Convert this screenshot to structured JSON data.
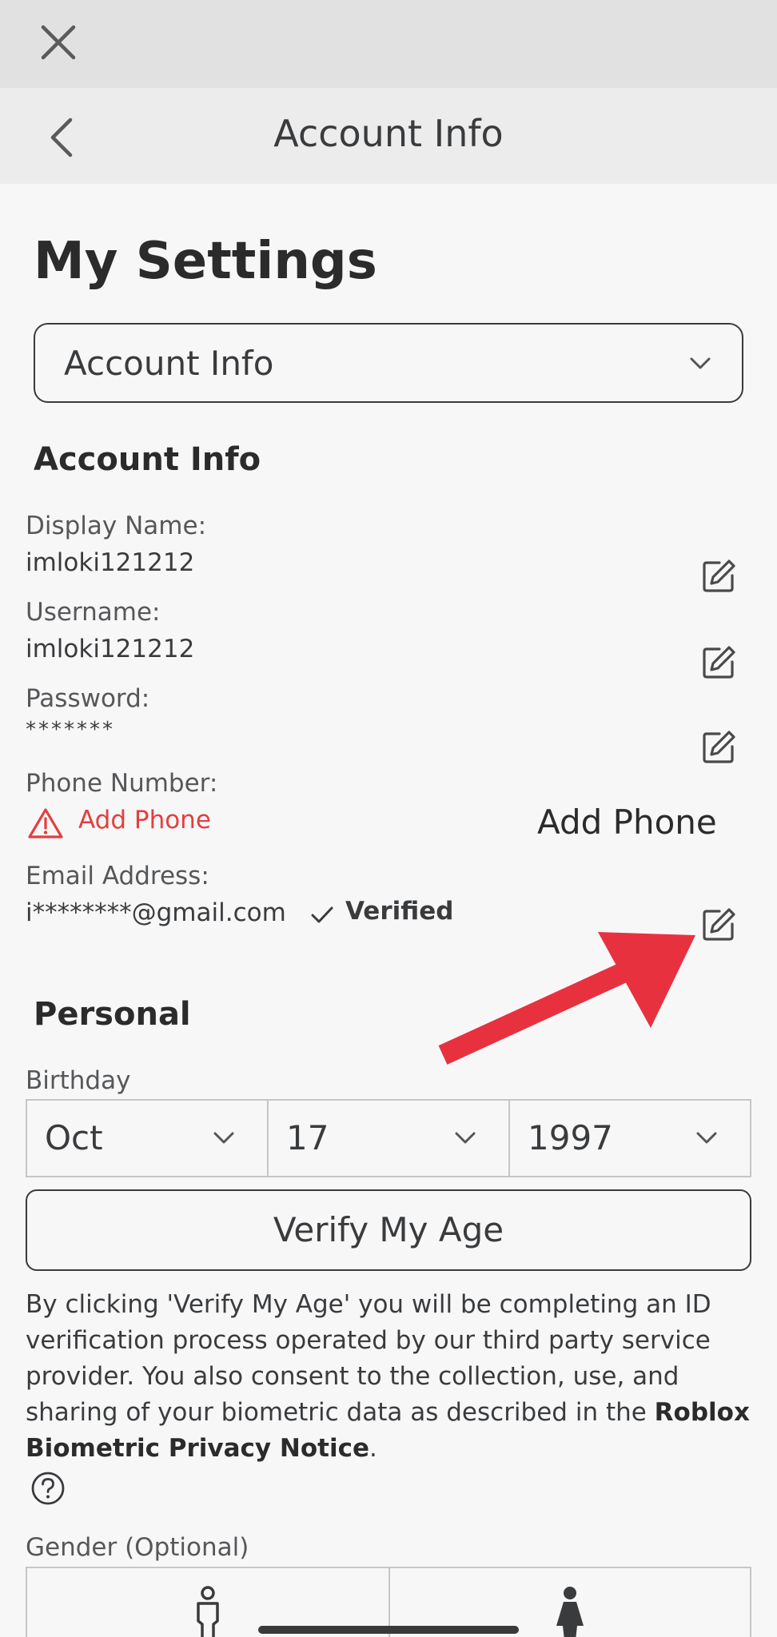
{
  "header": {
    "title": "Account Info"
  },
  "page": {
    "title": "My Settings"
  },
  "settings_dropdown": {
    "selected": "Account Info"
  },
  "account_info": {
    "section_title": "Account Info",
    "display_name": {
      "label": "Display Name:",
      "value": "imloki121212"
    },
    "username": {
      "label": "Username:",
      "value": "imloki121212"
    },
    "password": {
      "label": "Password:",
      "value": "*******"
    },
    "phone": {
      "label": "Phone Number:",
      "warning_text": "Add Phone",
      "action_label": "Add Phone"
    },
    "email": {
      "label": "Email Address:",
      "value": "i********@gmail.com",
      "status": "Verified"
    }
  },
  "personal": {
    "section_title": "Personal",
    "birthday_label": "Birthday",
    "birthday": {
      "month": "Oct",
      "day": "17",
      "year": "1997"
    },
    "verify_button": "Verify My Age",
    "disclaimer_text": "By clicking 'Verify My Age' you will be completing an ID verification process operated by our third party service provider. You also consent to the collection, use, and sharing of your biometric data as described in the ",
    "disclaimer_link": "Roblox Biometric Privacy Notice",
    "disclaimer_end": ".",
    "gender_label": "Gender (Optional)"
  },
  "icons": [
    "close-icon",
    "back-arrow-icon",
    "chevron-down-icon",
    "edit-icon",
    "warning-icon",
    "check-icon",
    "help-icon",
    "male-icon",
    "female-icon",
    "arrow-annotation"
  ],
  "colors": {
    "warning": "#e53e3e",
    "annotation_arrow": "#e8313f",
    "text": "#393b3d"
  }
}
